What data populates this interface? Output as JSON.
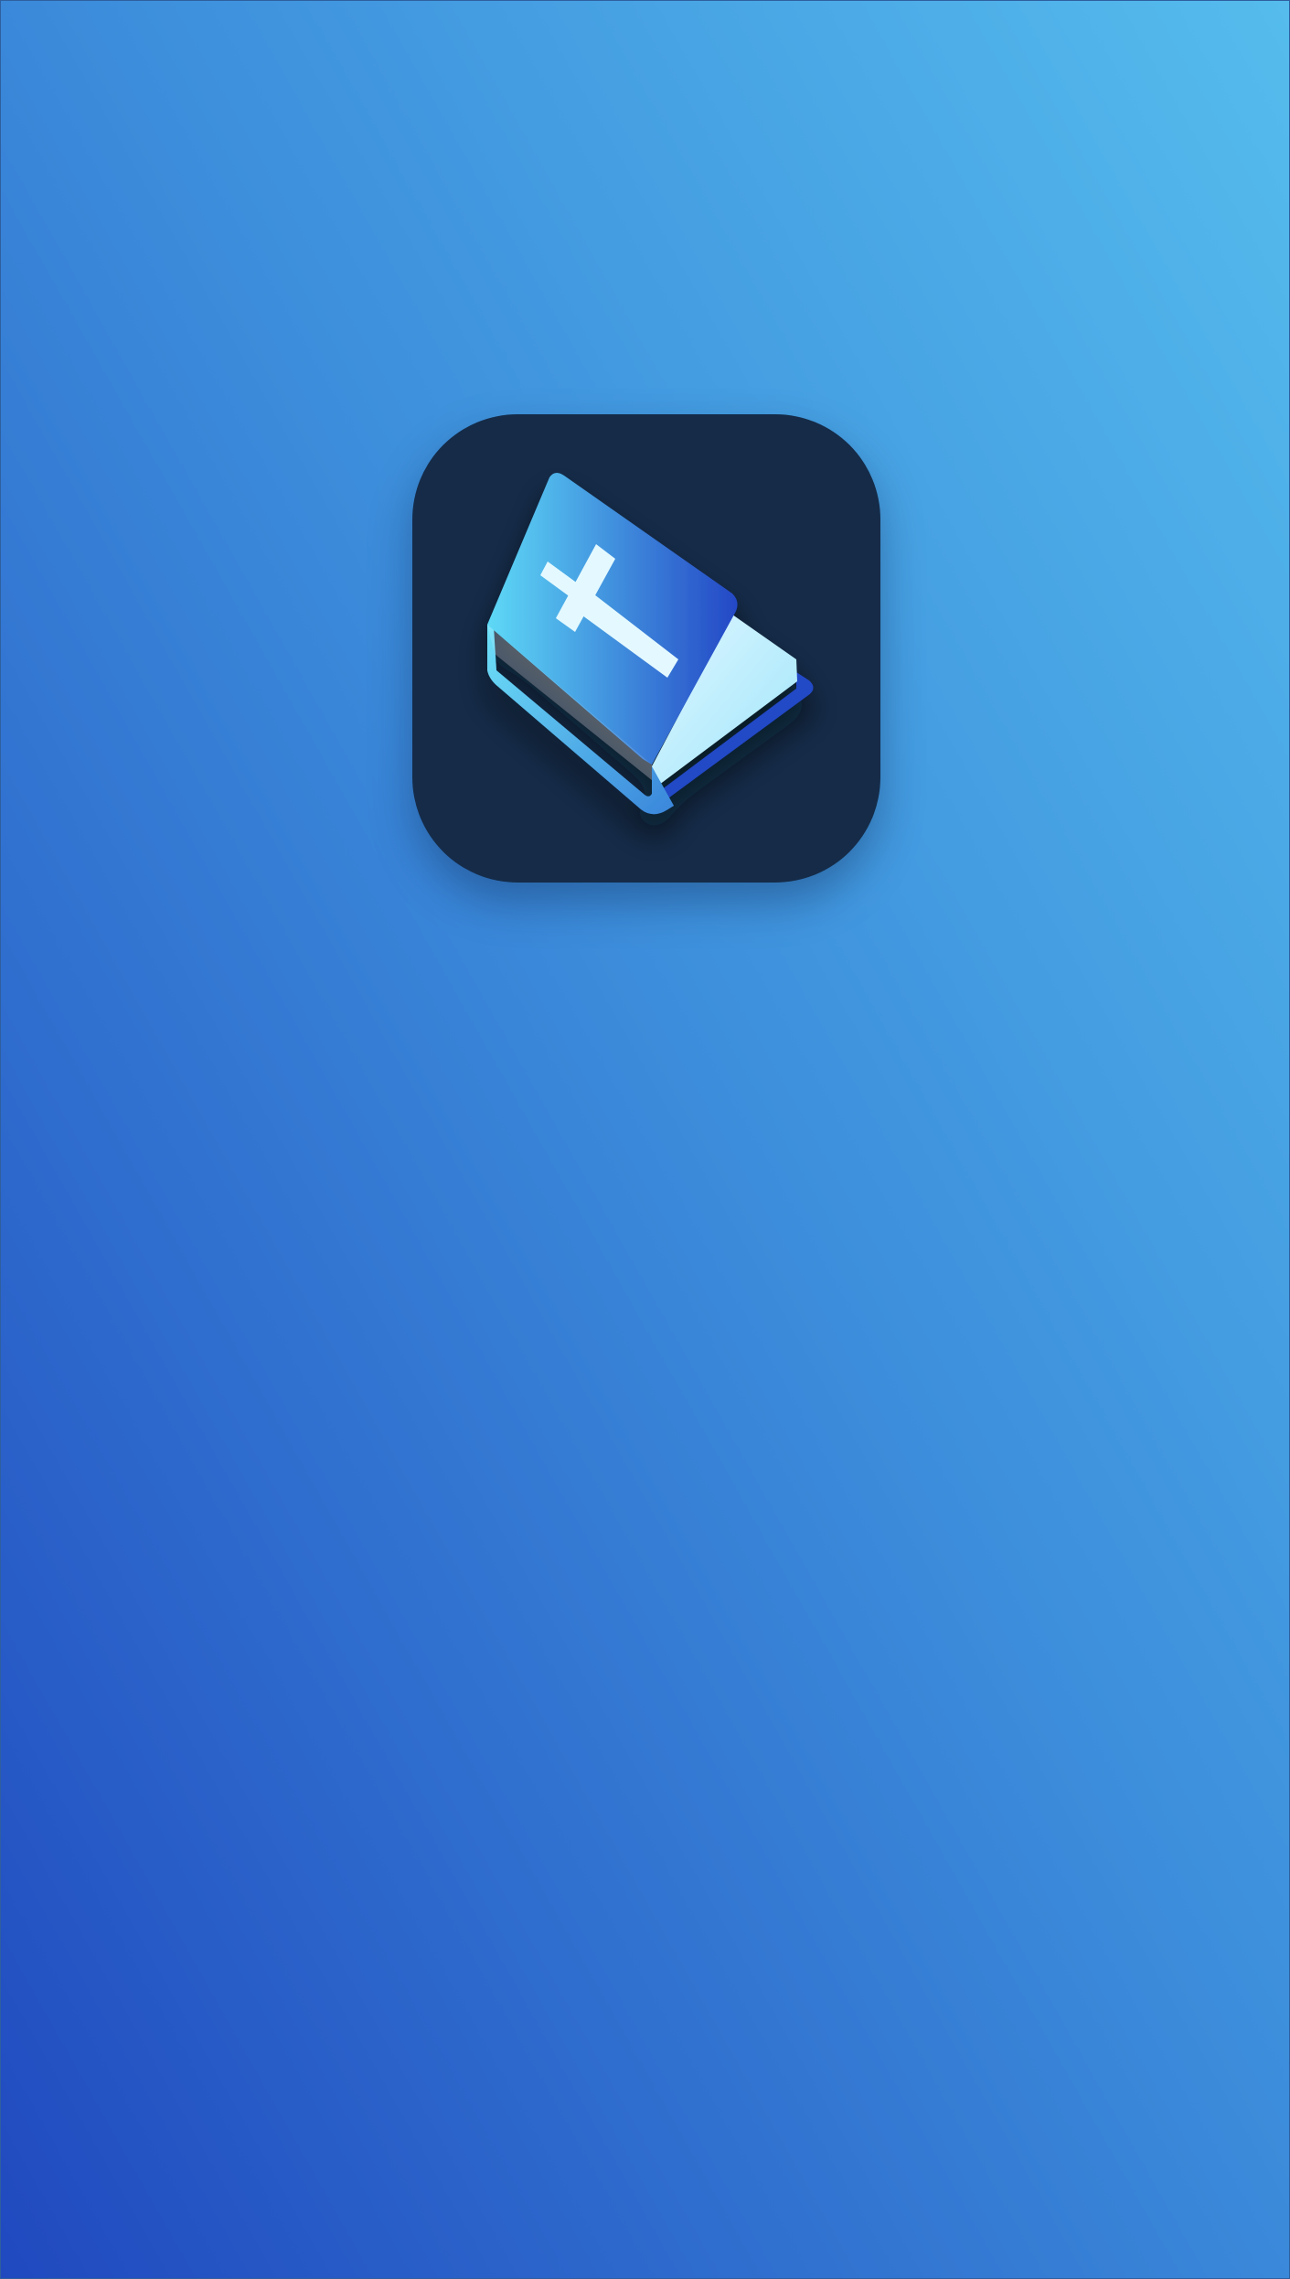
{
  "screen": {
    "background_gradient": {
      "top_right": "#55bced",
      "middle": "#3d8fdc",
      "bottom_left": "#2049bf"
    }
  },
  "app_icon": {
    "icon_name": "bible-book-icon",
    "tile_color": "#152b48",
    "book_cover_light": "#5ed9f6",
    "book_cover_dark": "#2448c6",
    "pages_color": "#dff6ff",
    "cross_color": "#e4f9ff"
  }
}
